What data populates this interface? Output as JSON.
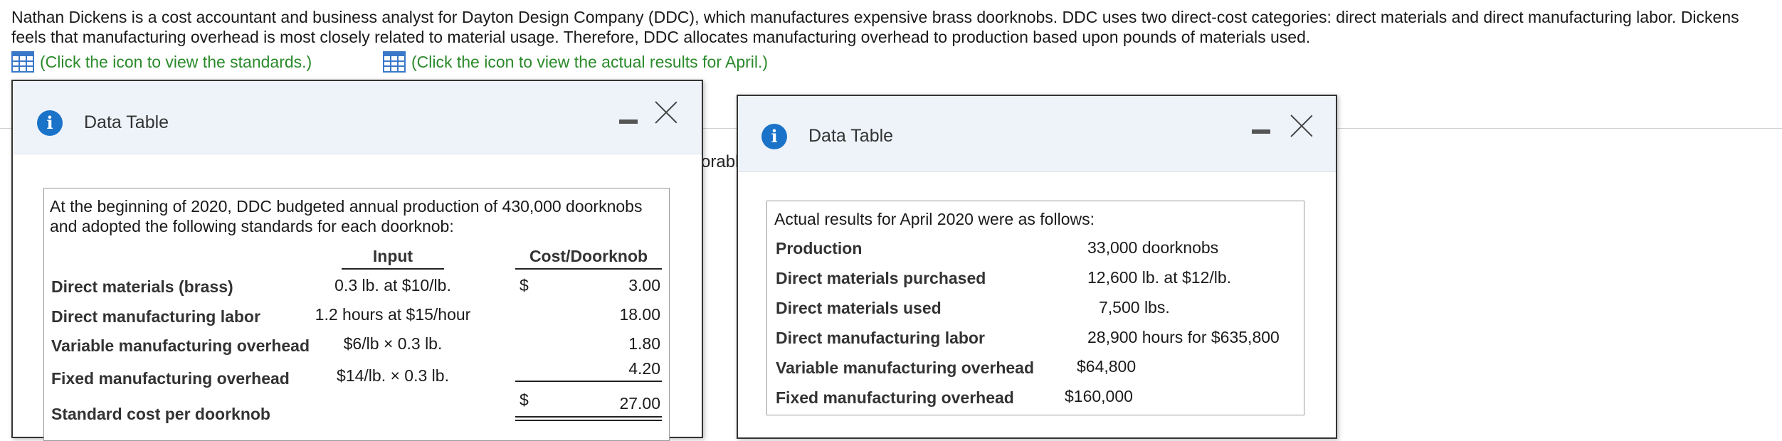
{
  "intro": "Nathan Dickens is a cost accountant and business analyst for Dayton Design Company (DDC), which manufactures expensive brass doorknobs. DDC uses two direct-cost categories: direct materials and direct manufacturing labor. Dickens feels that manufacturing overhead is most closely related to material usage. Therefore, DDC allocates manufacturing overhead to production based upon pounds of materials used.",
  "links": {
    "standards": "(Click the icon to view the standards.)",
    "actual": "(Click the icon to view the actual results for April.)",
    "icon": "table-grid-icon"
  },
  "background_fragment": "orabl",
  "colors": {
    "link": "#2a8a2a",
    "info_icon": "#1a73c8",
    "header_bg": "#eef3fa"
  },
  "dialog_standards": {
    "info_glyph": "i",
    "title": "Data Table",
    "intro": [
      "At the beginning of 2020, DDC budgeted annual production of 430,000 doorknobs",
      "and adopted the following standards for each doorknob:"
    ],
    "headers": {
      "input": "Input",
      "cost": "Cost/Doorknob"
    },
    "rows": [
      {
        "label": "Direct materials (brass)",
        "input": "0.3 lb. at $10/lb.",
        "dollar": "$",
        "cost": "3.00"
      },
      {
        "label": "Direct manufacturing labor",
        "input": "1.2 hours at $15/hour",
        "dollar": "",
        "cost": "18.00"
      },
      {
        "label": "Variable manufacturing overhead",
        "input": "$6/lb × 0.3 lb.",
        "dollar": "",
        "cost": "1.80"
      },
      {
        "label": "Fixed manufacturing overhead",
        "input": "$14/lb. × 0.3 lb.",
        "dollar": "",
        "cost": "4.20"
      }
    ],
    "total": {
      "label": "Standard cost per doorknob",
      "dollar": "$",
      "cost": "27.00"
    }
  },
  "dialog_actual": {
    "info_glyph": "i",
    "title": "Data Table",
    "intro": "Actual results for April 2020 were as follows:",
    "rows": [
      {
        "label": "Production",
        "value": "33,000 doorknobs"
      },
      {
        "label": "Direct materials purchased",
        "value": "12,600 lb. at $12/lb."
      },
      {
        "label": "Direct materials used",
        "value": "7,500 lbs."
      },
      {
        "label": "Direct manufacturing labor",
        "value": "28,900 hours for $635,800"
      },
      {
        "label": "Variable manufacturing overhead",
        "value": "$64,800"
      },
      {
        "label": "Fixed manufacturing overhead",
        "value": "$160,000"
      }
    ]
  }
}
